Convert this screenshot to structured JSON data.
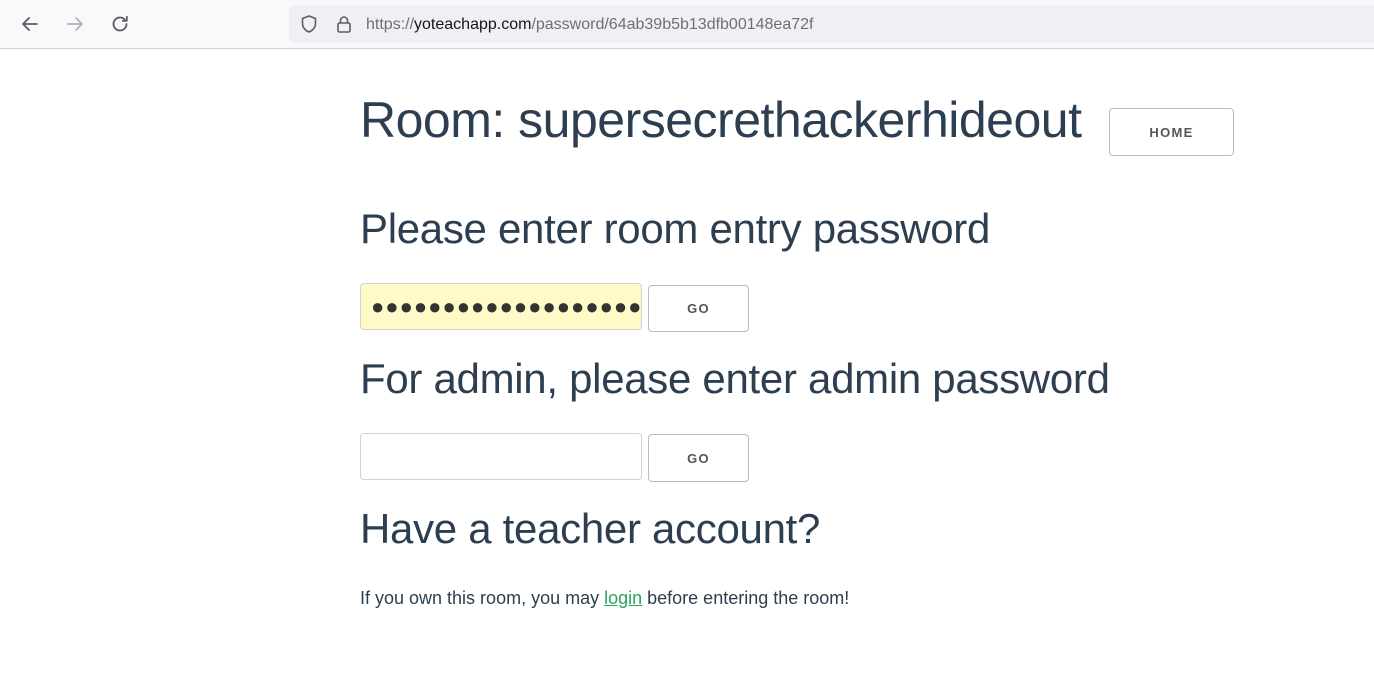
{
  "browser": {
    "url_scheme": "https://",
    "url_host": "yoteachapp.com",
    "url_path": "/password/64ab39b5b13dfb00148ea72f",
    "icons": [
      "back-arrow-icon",
      "forward-arrow-icon",
      "reload-icon",
      "shield-icon",
      "lock-icon"
    ]
  },
  "room": {
    "title": "Room: supersecrethackerhideout",
    "home_label": "HOME"
  },
  "entry": {
    "heading": "Please enter room entry password",
    "value_masked": "●●●●●●●●●●●●●●●●●●●●",
    "go_label": "GO"
  },
  "admin": {
    "heading": "For admin, please enter admin password",
    "value": "",
    "go_label": "GO"
  },
  "teacher": {
    "heading": "Have a teacher account?",
    "text_before": "If you own this room, you may ",
    "link_label": "login",
    "text_after": " before entering the room!"
  },
  "colors": {
    "text": "#2c3e50",
    "link": "#26a65b",
    "autofill_bg": "#fffac8"
  }
}
